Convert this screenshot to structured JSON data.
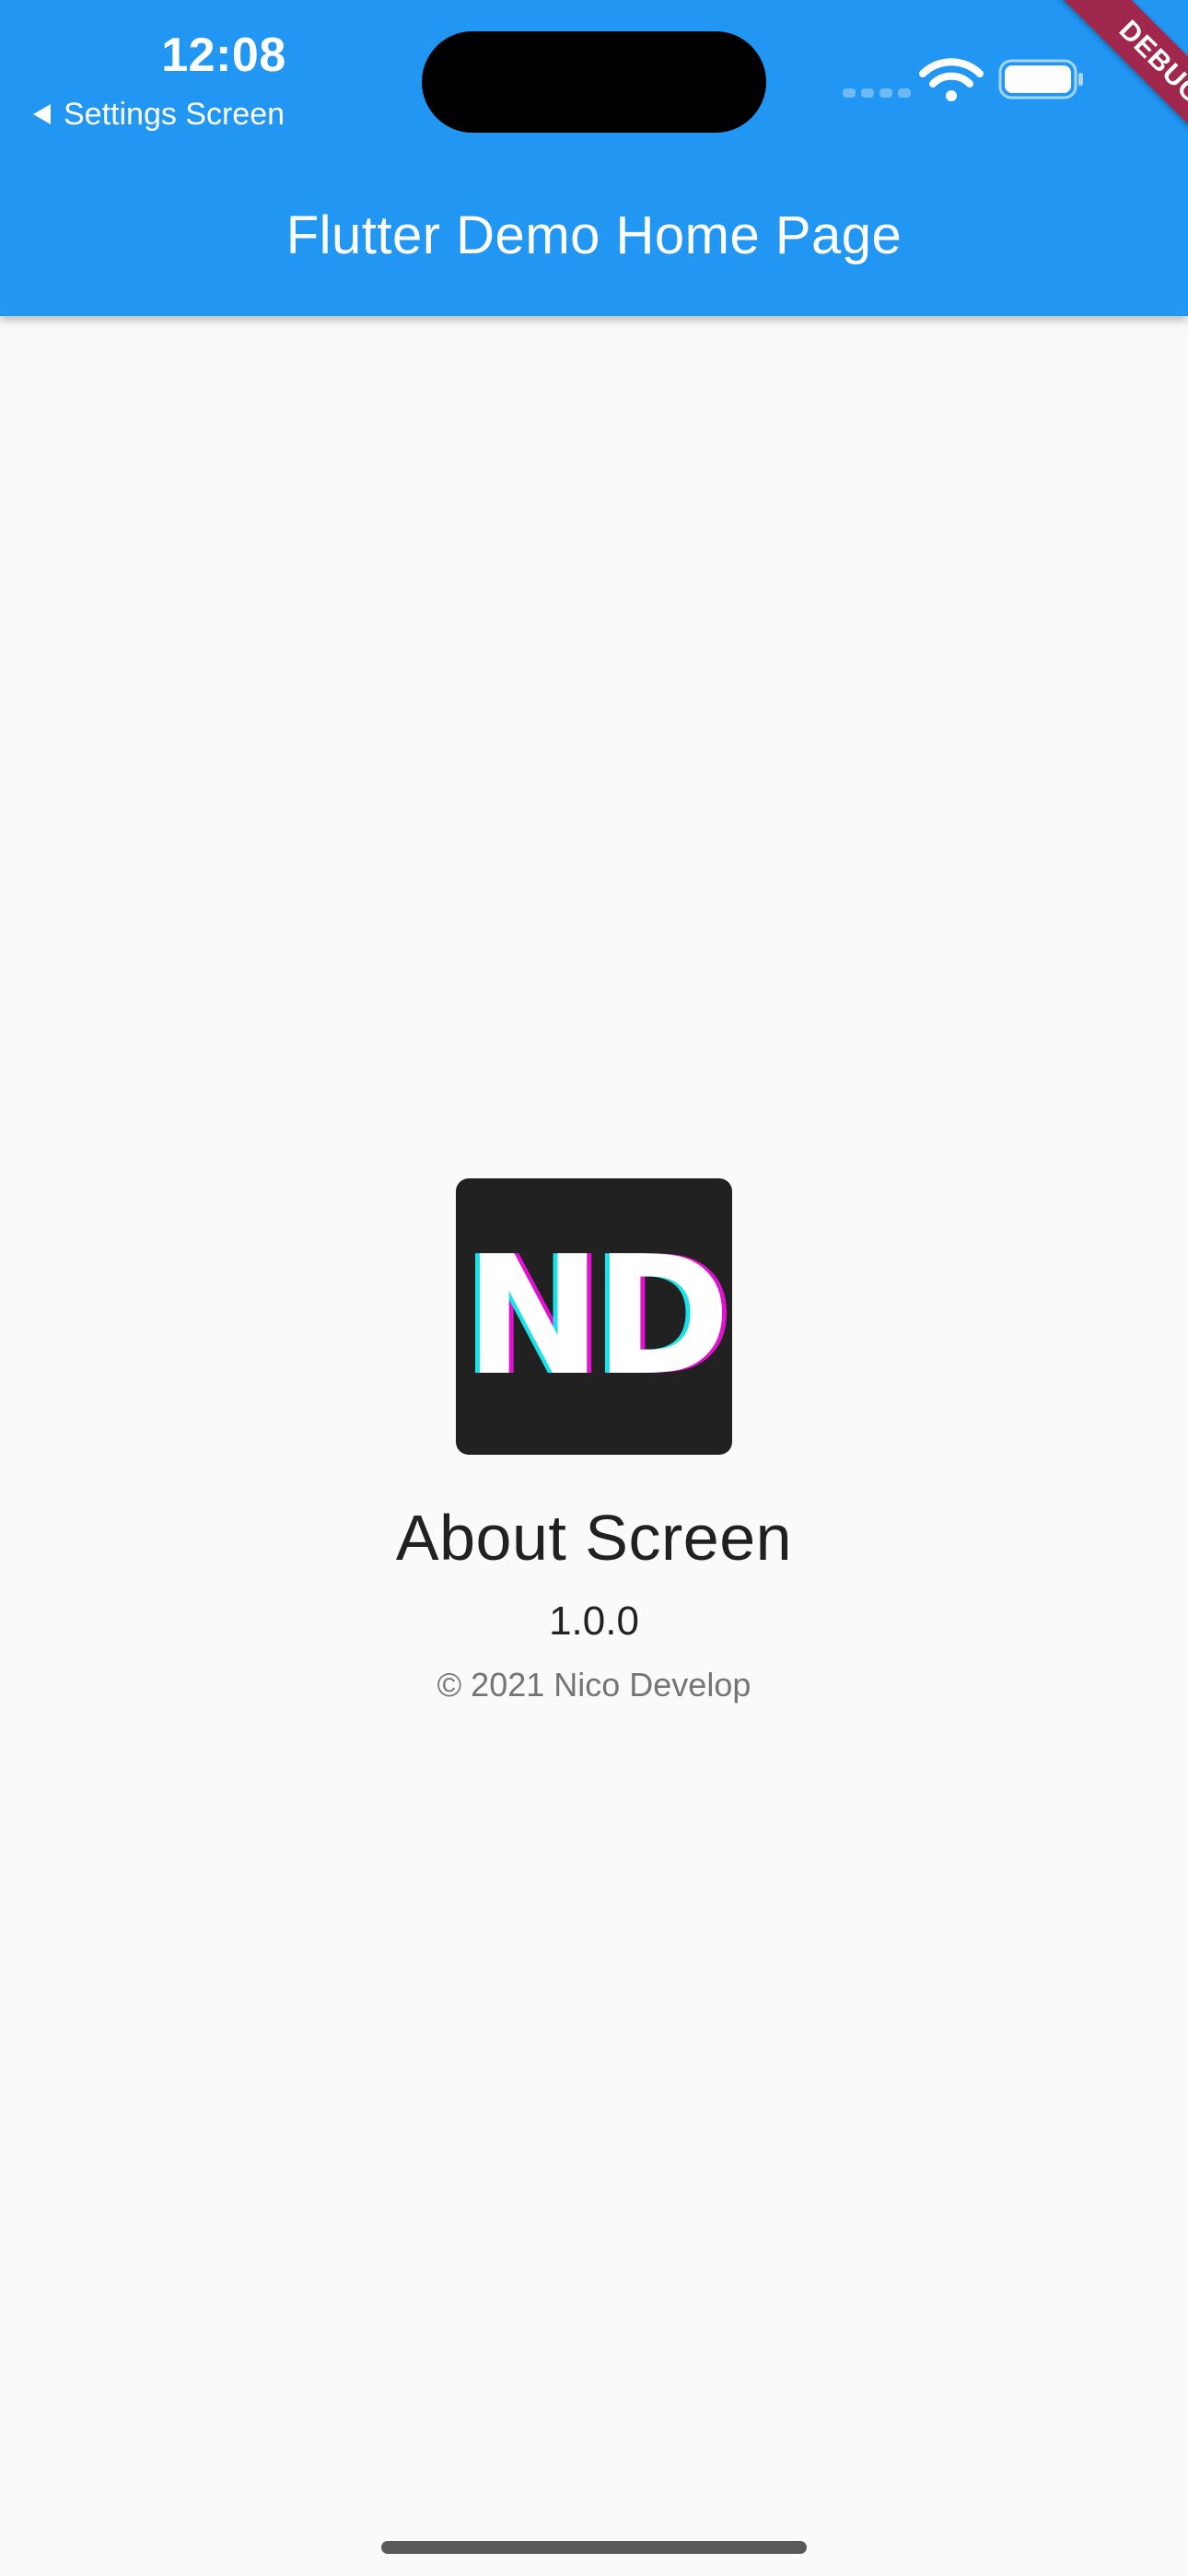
{
  "status_bar": {
    "time": "12:08",
    "back_label": "Settings Screen",
    "icons": [
      "signal-icon",
      "wifi-icon",
      "battery-icon"
    ]
  },
  "app_bar": {
    "title": "Flutter Demo Home Page",
    "color": "#2196f3"
  },
  "debug_banner": {
    "label": "DEBUG",
    "color": "#a0284c"
  },
  "about": {
    "logo_text": "ND",
    "app_name": "About Screen",
    "version": "1.0.0",
    "copyright": "© 2021 Nico Develop"
  }
}
